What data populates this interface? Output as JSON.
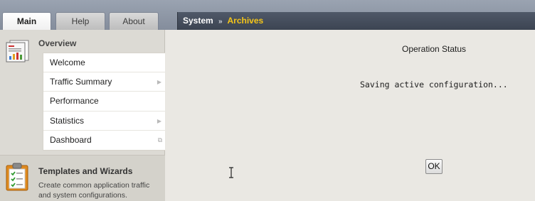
{
  "tabs": [
    {
      "label": "Main",
      "active": true
    },
    {
      "label": "Help",
      "active": false
    },
    {
      "label": "About",
      "active": false
    }
  ],
  "breadcrumb": {
    "section": "System",
    "separator": "»",
    "current": "Archives",
    "current_color": "#f5c518"
  },
  "sidebar": {
    "overview": {
      "title": "Overview",
      "icon": "report-icon",
      "items": [
        {
          "label": "Welcome",
          "indicator": "none"
        },
        {
          "label": "Traffic Summary",
          "indicator": "arrow"
        },
        {
          "label": "Performance",
          "indicator": "none"
        },
        {
          "label": "Statistics",
          "indicator": "arrow"
        },
        {
          "label": "Dashboard",
          "indicator": "external"
        }
      ]
    },
    "templates": {
      "icon": "clipboard-checklist-icon",
      "title": "Templates and Wizards",
      "description": "Create common application traffic and system configurations."
    }
  },
  "main": {
    "title": "Operation Status",
    "message": "Saving active configuration...",
    "ok_label": "OK"
  },
  "glyphs": {
    "arrow": "▶",
    "external": "⧉"
  }
}
